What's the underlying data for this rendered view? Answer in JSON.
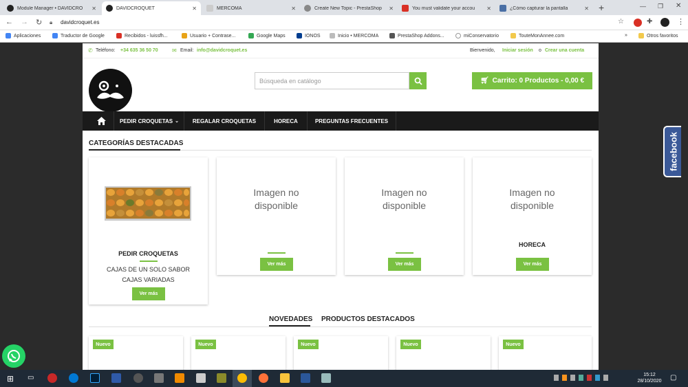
{
  "browser": {
    "tabs": [
      {
        "label": "Module Manager • DAVIDCRO",
        "active": false
      },
      {
        "label": "DAVIDCROQUET",
        "active": true
      },
      {
        "label": "MERCOMA",
        "active": false
      },
      {
        "label": "Create New Topic - PrestaShop",
        "active": false
      },
      {
        "label": "You must validate your accou",
        "active": false
      },
      {
        "label": "¿Cómo capturar la pantalla",
        "active": false
      }
    ],
    "new_tab": "+",
    "url": "davidcroquet.es",
    "bookmarks": [
      "Aplicaciones",
      "Traductor de Google",
      "Recibidos - luissfh...",
      "Usuario + Contrase...",
      "Google Maps",
      "IONOS",
      "Inicio • MERCOMA",
      "PrestaShop Addons...",
      "miConservatorio",
      "TouteMonAnnee.com"
    ],
    "more": "»",
    "other_favorites": "Otros favoritos"
  },
  "header": {
    "phone_label": "Teléfono:",
    "phone": "+34 635 36 50 70",
    "email_label": "Email:",
    "email": "info@davidcroquet.es",
    "welcome": "Bienvenido,",
    "login": "Iniciar sesión",
    "or": "o",
    "register": "Crear una cuenta",
    "search_placeholder": "Búsqueda en catálogo",
    "cart": "Carrito: 0 Productos - 0,00 €"
  },
  "nav": {
    "items": [
      "PEDIR CROQUETAS",
      "REGALAR CROQUETAS",
      "HORECA",
      "PREGUNTAS FRECUENTES"
    ]
  },
  "categories": {
    "title": "CATEGORÍAS DESTACADAS",
    "cards": [
      {
        "name": "PEDIR CROQUETAS",
        "sub1": "CAJAS DE UN SOLO SABOR",
        "sub2": "CAJAS VARIADAS",
        "button": "Ver más"
      },
      {
        "noimg1": "Imagen no",
        "noimg2": "disponible",
        "button": "Ver más"
      },
      {
        "noimg1": "Imagen no",
        "noimg2": "disponible",
        "button": "Ver más"
      },
      {
        "noimg1": "Imagen no",
        "noimg2": "disponible",
        "name": "HORECA",
        "button": "Ver más"
      }
    ]
  },
  "products": {
    "tabs": [
      "NOVEDADES",
      "PRODUCTOS DESTACADOS"
    ],
    "badge": "Nuevo"
  },
  "social": {
    "facebook": "facebook"
  },
  "taskbar": {
    "time": "15:12",
    "date": "28/10/2020"
  },
  "colors": {
    "accent": "#7ac142",
    "nav_bg": "#1a1a1a",
    "background": "#2b2b2b"
  }
}
